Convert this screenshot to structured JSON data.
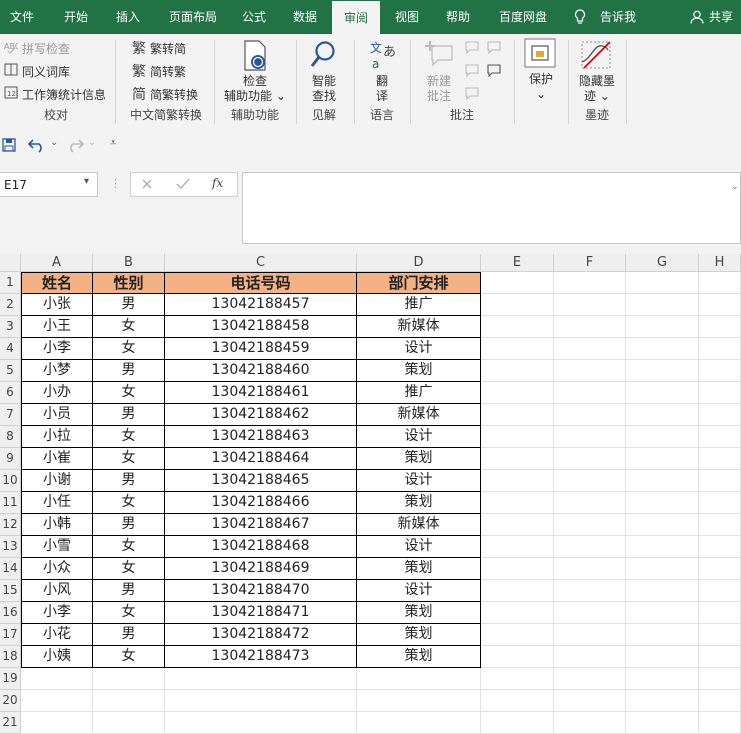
{
  "menu": {
    "tabs": [
      "文件",
      "开始",
      "插入",
      "页面布局",
      "公式",
      "数据",
      "审阅",
      "视图",
      "帮助",
      "百度网盘"
    ],
    "tell_me": "告诉我",
    "share": "共享"
  },
  "ribbon": {
    "proofing": {
      "spelling": "拼写检查",
      "thesaurus": "同义词库",
      "workbook_stats": "工作簿统计信息",
      "label": "校对"
    },
    "chinese": {
      "to_simplified": "繁转简",
      "to_traditional": "简转繁",
      "convert": "简繁转换",
      "label": "中文简繁转换"
    },
    "accessibility": {
      "check_line1": "检查",
      "check_line2": "辅助功能",
      "label": "辅助功能"
    },
    "insights": {
      "smart_line1": "智能",
      "smart_line2": "查找",
      "label": "见解"
    },
    "language": {
      "translate_line1": "翻",
      "translate_line2": "译",
      "label": "语言"
    },
    "comments": {
      "new_line1": "新建",
      "new_line2": "批注",
      "label": "批注"
    },
    "protect": {
      "protect": "保护"
    },
    "ink": {
      "hide_line1": "隐藏墨",
      "hide_line2": "迹",
      "label": "墨迹"
    }
  },
  "namebox": {
    "value": "E17"
  },
  "formula": {
    "value": ""
  },
  "columns": [
    "A",
    "B",
    "C",
    "D",
    "E",
    "F",
    "G",
    "H"
  ],
  "table": {
    "headers": [
      "姓名",
      "性别",
      "电话号码",
      "部门安排"
    ],
    "rows": [
      [
        "小张",
        "男",
        "13042188457",
        "推广"
      ],
      [
        "小王",
        "女",
        "13042188458",
        "新媒体"
      ],
      [
        "小李",
        "女",
        "13042188459",
        "设计"
      ],
      [
        "小梦",
        "男",
        "13042188460",
        "策划"
      ],
      [
        "小办",
        "女",
        "13042188461",
        "推广"
      ],
      [
        "小员",
        "男",
        "13042188462",
        "新媒体"
      ],
      [
        "小拉",
        "女",
        "13042188463",
        "设计"
      ],
      [
        "小崔",
        "女",
        "13042188464",
        "策划"
      ],
      [
        "小谢",
        "男",
        "13042188465",
        "设计"
      ],
      [
        "小任",
        "女",
        "13042188466",
        "策划"
      ],
      [
        "小韩",
        "男",
        "13042188467",
        "新媒体"
      ],
      [
        "小雪",
        "女",
        "13042188468",
        "设计"
      ],
      [
        "小众",
        "女",
        "13042188469",
        "策划"
      ],
      [
        "小风",
        "男",
        "13042188470",
        "设计"
      ],
      [
        "小李",
        "女",
        "13042188471",
        "策划"
      ],
      [
        "小花",
        "男",
        "13042188472",
        "策划"
      ],
      [
        "小姨",
        "女",
        "13042188473",
        "策划"
      ]
    ]
  },
  "row_numbers": [
    "1",
    "2",
    "3",
    "4",
    "5",
    "6",
    "7",
    "8",
    "9",
    "10",
    "11",
    "12",
    "13",
    "14",
    "15",
    "16",
    "17",
    "18",
    "19",
    "20",
    "21"
  ],
  "colors": {
    "excel_green": "#217346",
    "header_fill": "#f4b183"
  }
}
